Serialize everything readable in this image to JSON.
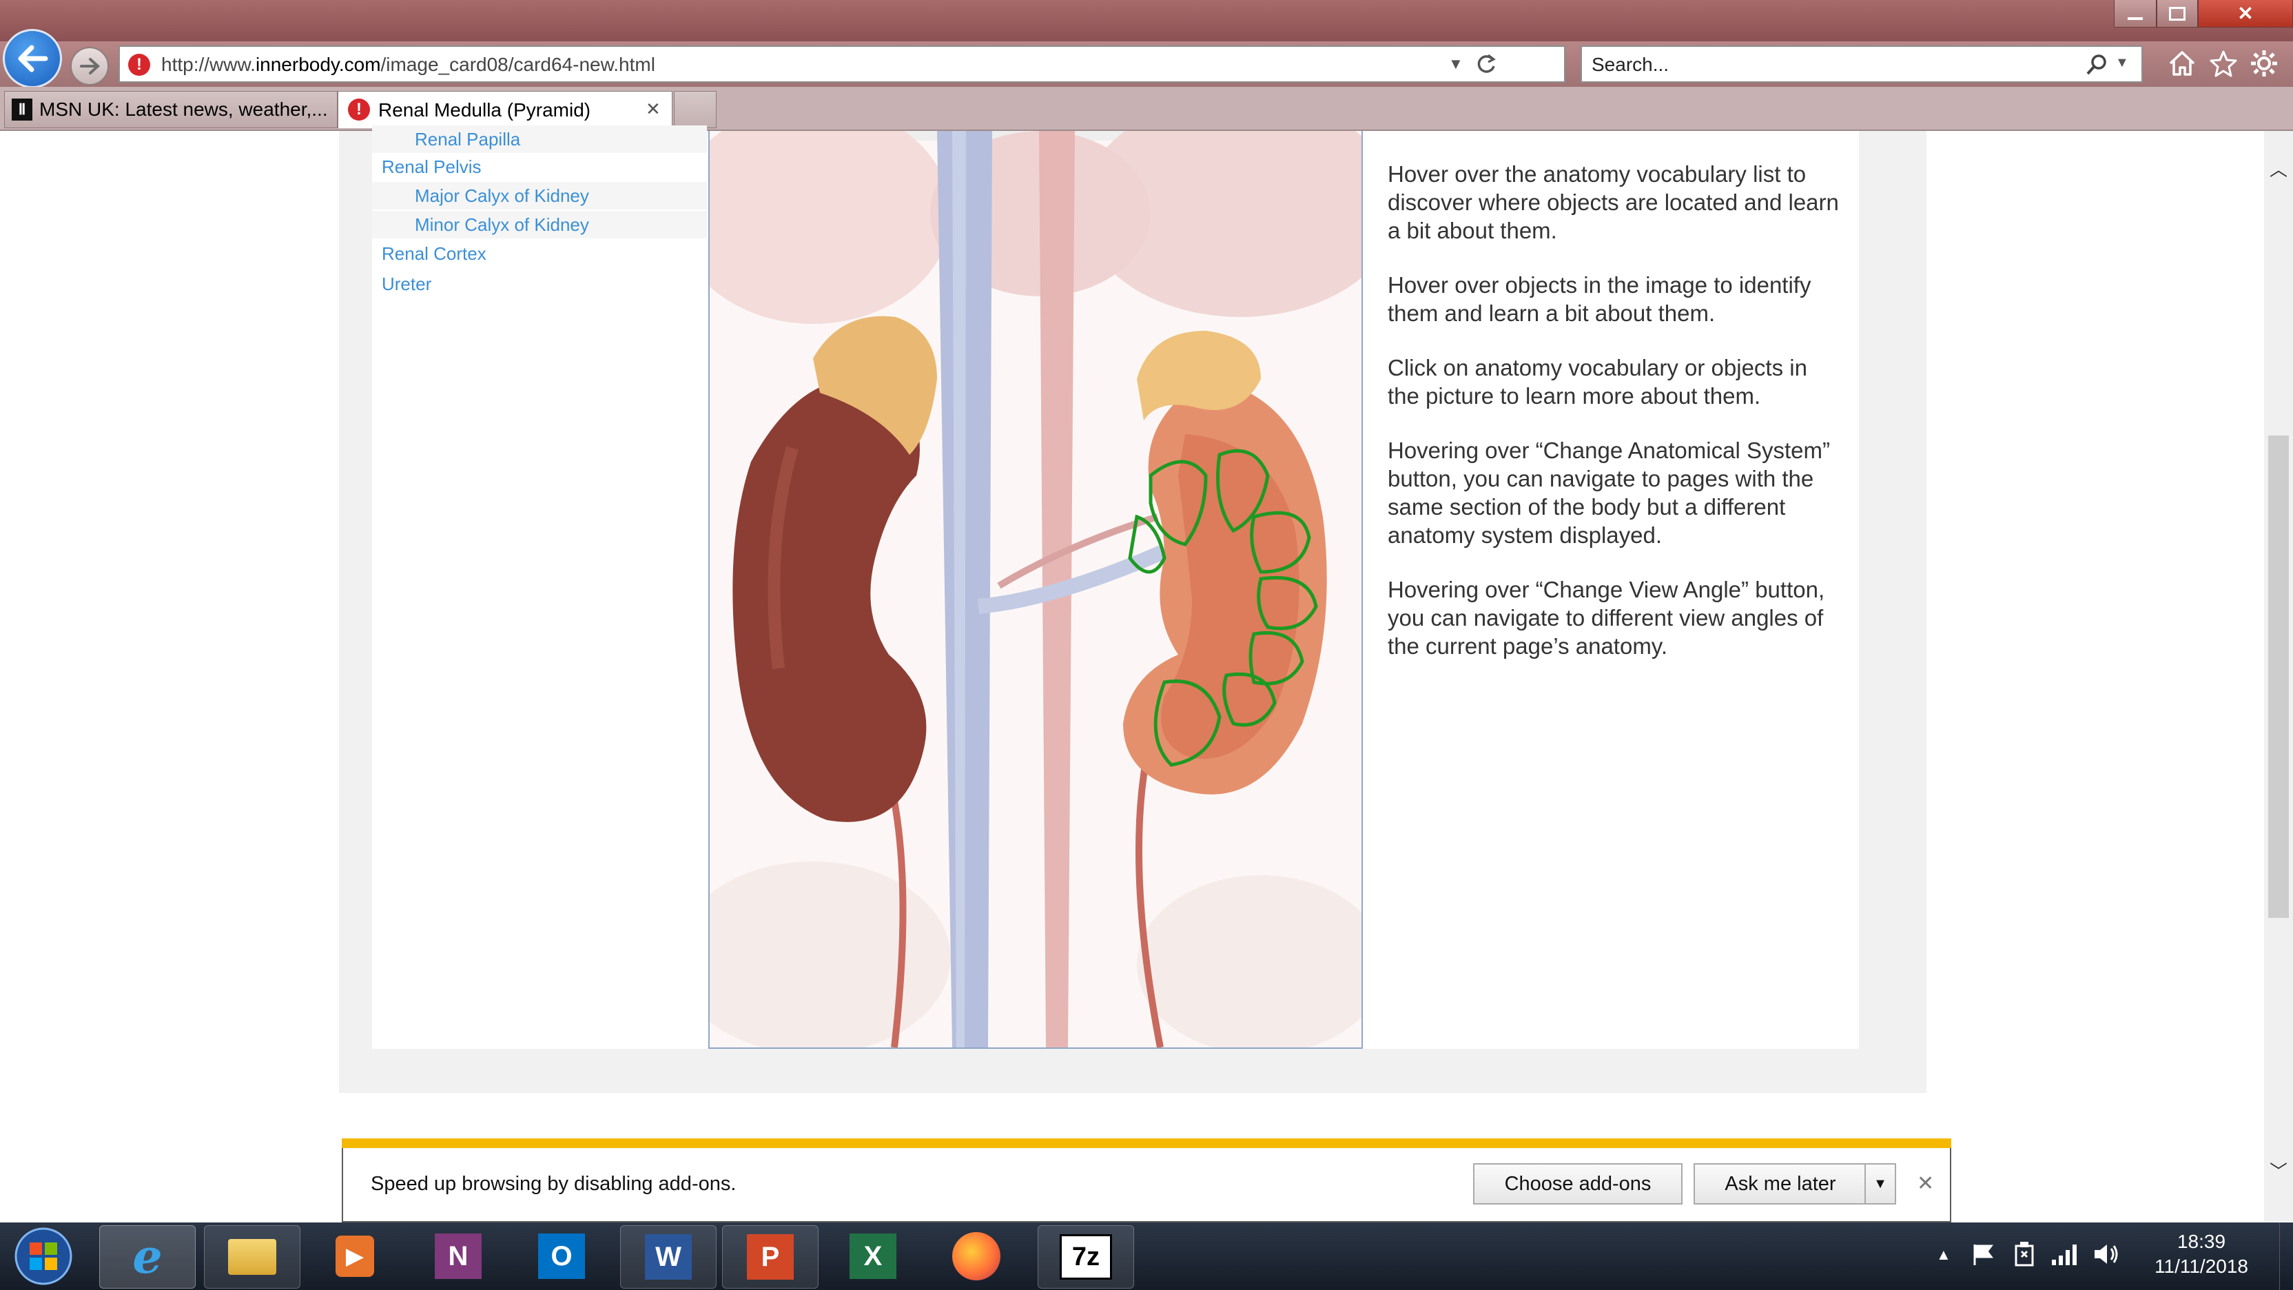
{
  "browser": {
    "address": {
      "prefix": "http://www.",
      "domain": "innerbody.com",
      "path": "/image_card08/card64-new.html"
    },
    "search_placeholder": "Search...",
    "tabs": [
      {
        "label": "MSN UK: Latest news, weather,..."
      },
      {
        "label": "Renal Medulla (Pyramid)",
        "close": "✕"
      }
    ]
  },
  "vocabulary": [
    {
      "label": "Renal Papilla"
    },
    {
      "label": "Renal Pelvis"
    },
    {
      "label": "Major Calyx of Kidney"
    },
    {
      "label": "Minor Calyx of Kidney"
    },
    {
      "label": "Renal Cortex"
    },
    {
      "label": "Ureter"
    }
  ],
  "help": [
    "Hover over the anatomy vocabulary list to discover where objects are located and learn a bit about them.",
    "Hover over objects in the image to identify them and learn a bit about them.",
    "Click on anatomy vocabulary or objects in the picture to learn more about them.",
    "Hovering over “Change Anatomical System” button, you can navigate to pages with the same section of the body but a different anatomy system displayed.",
    "Hovering over “Change View Angle” button, you can navigate to different view angles of the current page’s anatomy."
  ],
  "notification": {
    "message": "Speed up browsing by disabling add-ons.",
    "choose_label": "Choose add-ons",
    "later_label": "Ask me later",
    "close": "✕"
  },
  "taskbar": {
    "time": "18:39",
    "date": "11/11/2018",
    "apps": [
      "start",
      "internet-explorer",
      "file-explorer",
      "media-player",
      "onenote",
      "outlook",
      "word",
      "powerpoint",
      "excel",
      "firefox",
      "7zip"
    ]
  },
  "colors": {
    "accent_link": "#3a8fd6",
    "notification_bar": "#f5b800",
    "highlight_outline": "#1d9a22"
  }
}
